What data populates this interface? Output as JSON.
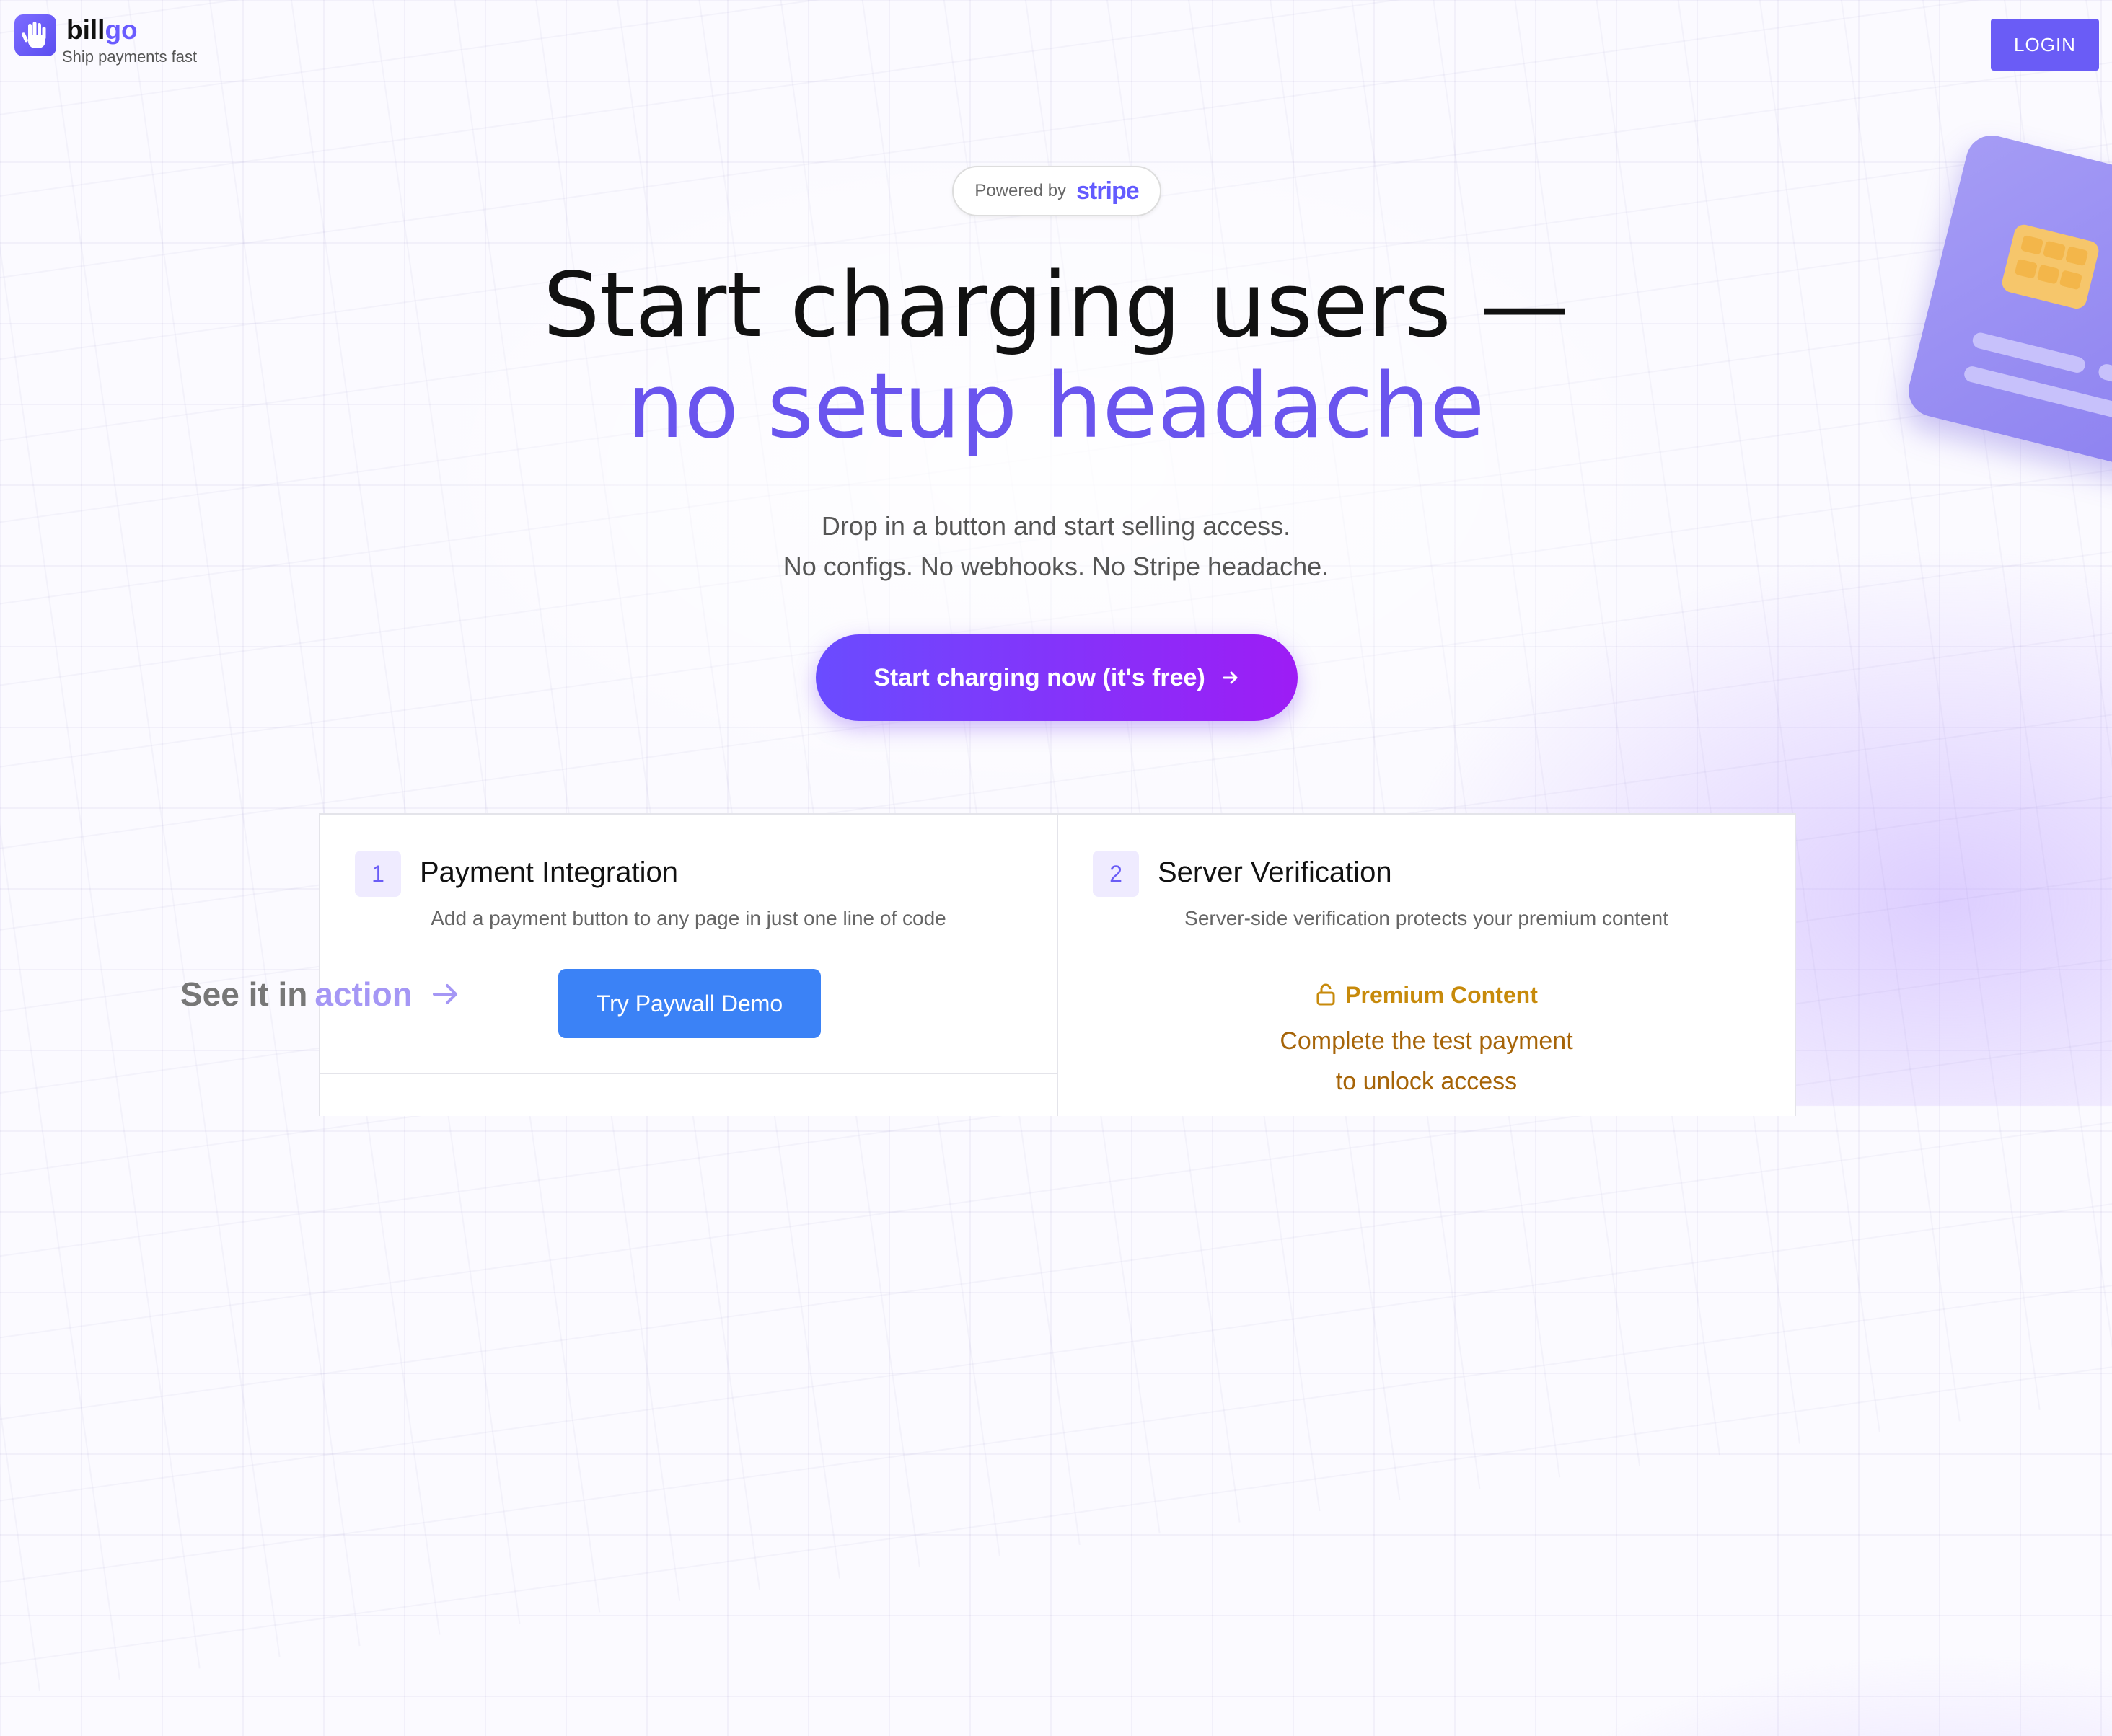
{
  "brand": {
    "name_a": "bill",
    "name_b": "go",
    "tagline": "Ship payments fast",
    "logo_icon": "hand-icon"
  },
  "header": {
    "login_label": "LOGIN"
  },
  "hero": {
    "powered_by": "Powered by",
    "powered_brand": "stripe",
    "title_line1": "Start charging users —",
    "title_line2": "no setup headache",
    "subtitle_line1": "Drop in a button and start selling access.",
    "subtitle_line2": "No configs. No webhooks. No Stripe headache.",
    "cta_label": "Start charging now (it's free)"
  },
  "steps": [
    {
      "number": "1",
      "title": "Payment Integration",
      "description": "Add a payment button to any page in just one line of code",
      "button_label": "Try Paywall Demo"
    },
    {
      "number": "2",
      "title": "Server Verification",
      "description": "Server-side verification protects your premium content",
      "premium_label": "Premium Content",
      "premium_msg_line1": "Complete the test payment",
      "premium_msg_line2": "to unlock access"
    }
  ],
  "see_action": {
    "prefix": "See it in",
    "highlight": "action"
  },
  "colors": {
    "accent": "#6a5cf6",
    "headline_accent": "#6a55ee",
    "demo_button": "#3b82f6",
    "premium": "#c78a0b"
  }
}
